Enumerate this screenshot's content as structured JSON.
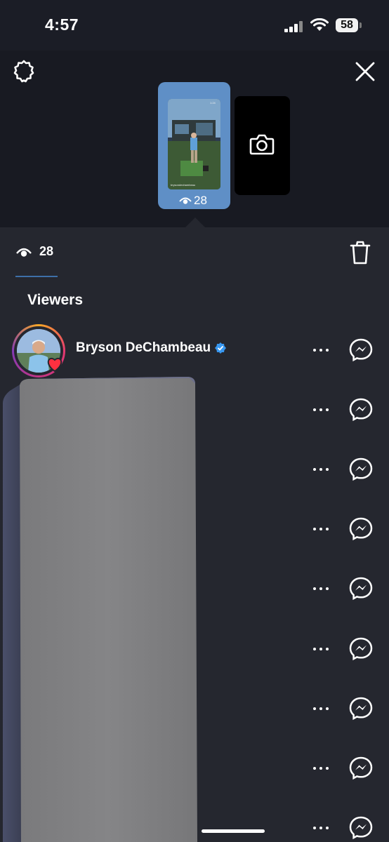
{
  "status_bar": {
    "time": "4:57",
    "battery": "58",
    "signal_icon": "signal-icon",
    "wifi_icon": "wifi-icon"
  },
  "header": {
    "settings_icon": "gear-icon",
    "close_icon": "close-icon"
  },
  "story_thumb": {
    "view_count": "28",
    "thumb_caption": "brysondechambeau",
    "thumb_time": "1:24"
  },
  "add_story": {
    "icon": "camera-icon"
  },
  "views_panel": {
    "view_count": "28",
    "trash_icon": "trash-icon",
    "section_title": "Viewers"
  },
  "viewers": [
    {
      "name": "Bryson DeChambeau",
      "verified": true,
      "liked": true
    },
    {
      "name": "",
      "verified": false,
      "liked": false
    },
    {
      "name": "",
      "verified": false,
      "liked": false
    },
    {
      "name": "",
      "verified": false,
      "liked": false
    },
    {
      "name": "",
      "verified": false,
      "liked": false
    },
    {
      "name": "",
      "verified": false,
      "liked": false
    },
    {
      "name": "",
      "verified": false,
      "liked": false
    },
    {
      "name": "",
      "verified": false,
      "liked": false
    },
    {
      "name": "",
      "verified": false,
      "liked": false
    }
  ],
  "colors": {
    "panel_bg": "#25272f",
    "top_bg": "#181a22",
    "accent": "#3d6fa8",
    "verified_blue": "#3897f0",
    "like_red": "#ff3040"
  }
}
